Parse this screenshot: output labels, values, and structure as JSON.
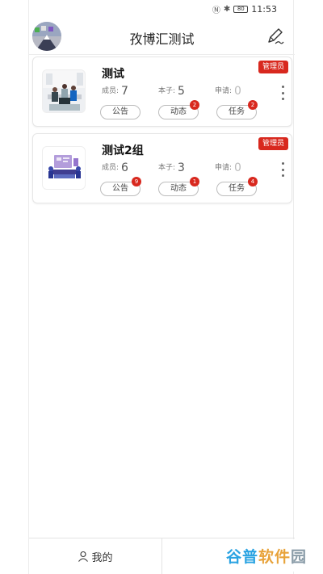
{
  "status_bar": {
    "nfc_icon": "nfc-icon",
    "bluetooth_icon": "bluetooth-icon",
    "battery": "80",
    "time": "11:53"
  },
  "header": {
    "title": "孜博汇测试",
    "avatar_icon": "user-avatar",
    "edit_icon": "edit-pen-icon"
  },
  "groups": [
    {
      "name": "测试",
      "badge": "管理员",
      "stats": [
        {
          "label": "成员:",
          "value": "7"
        },
        {
          "label": "本子:",
          "value": "5"
        },
        {
          "label": "申请:",
          "value": "0"
        }
      ],
      "actions": [
        {
          "label": "公告",
          "badge": ""
        },
        {
          "label": "动态",
          "badge": "2"
        },
        {
          "label": "任务",
          "badge": "2"
        }
      ]
    },
    {
      "name": "测试2组",
      "badge": "管理员",
      "stats": [
        {
          "label": "成员:",
          "value": "6"
        },
        {
          "label": "本子:",
          "value": "3"
        },
        {
          "label": "申请:",
          "value": "0"
        }
      ],
      "actions": [
        {
          "label": "公告",
          "badge": "9"
        },
        {
          "label": "动态",
          "badge": "1"
        },
        {
          "label": "任务",
          "badge": "4"
        }
      ]
    }
  ],
  "bottom_nav": {
    "mine_label": "我的",
    "mine_icon": "person-icon",
    "list_icon": "list-icon"
  },
  "watermark": {
    "part1": "谷普",
    "part2": "软件",
    "part3": "园"
  },
  "colors": {
    "accent_red": "#d8281e",
    "border": "#e6e6e6"
  }
}
